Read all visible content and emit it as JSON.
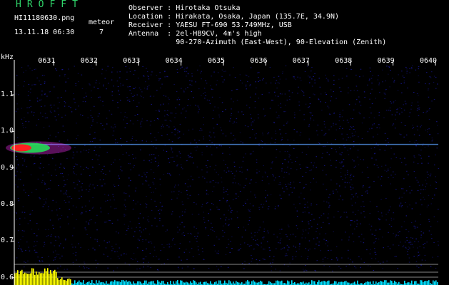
{
  "header": {
    "app_title": "HROFFT",
    "filename": "HI11180630.png",
    "datetime": "13.11.18 06:30",
    "meteor_label": "meteor",
    "meteor_count": "7",
    "observer": "Observer : Hirotaka Otsuka",
    "location": "Location : Hirakata, Osaka, Japan (135.7E, 34.9N)",
    "receiver": "Receiver : YAESU FT-690 53.749MHz, USB",
    "antenna": "Antenna  : 2el-HB9CV, 4m's high",
    "antenna2": "           90-270-Azimuth (East-West), 90-Elevation (Zenith)"
  },
  "chart_data": {
    "type": "heatmap",
    "ylabel": "kHz",
    "x_ticks": [
      "0631",
      "0632",
      "0633",
      "0634",
      "0635",
      "0636",
      "0637",
      "0638",
      "0639",
      "0640"
    ],
    "y_ticks": [
      "1.1",
      "1.0",
      "0.9",
      "0.8",
      "0.7",
      "0.6"
    ],
    "ylim": [
      0.58,
      1.18
    ],
    "carrier_khz": 0.965,
    "meteor_echo": {
      "start_minute": "0631",
      "freq_khz": 0.955
    }
  },
  "colors": {
    "background": "#000000",
    "noise": "#1a1aa0",
    "carrier": "#5aa0ff",
    "echo_core": "#ff2020",
    "echo_mid": "#22dd55",
    "echo_edge": "#ff30ff",
    "bottom_bars": "#ffff00",
    "bottom_noise": "#00e0ff",
    "label_green": "#2fd46a"
  }
}
